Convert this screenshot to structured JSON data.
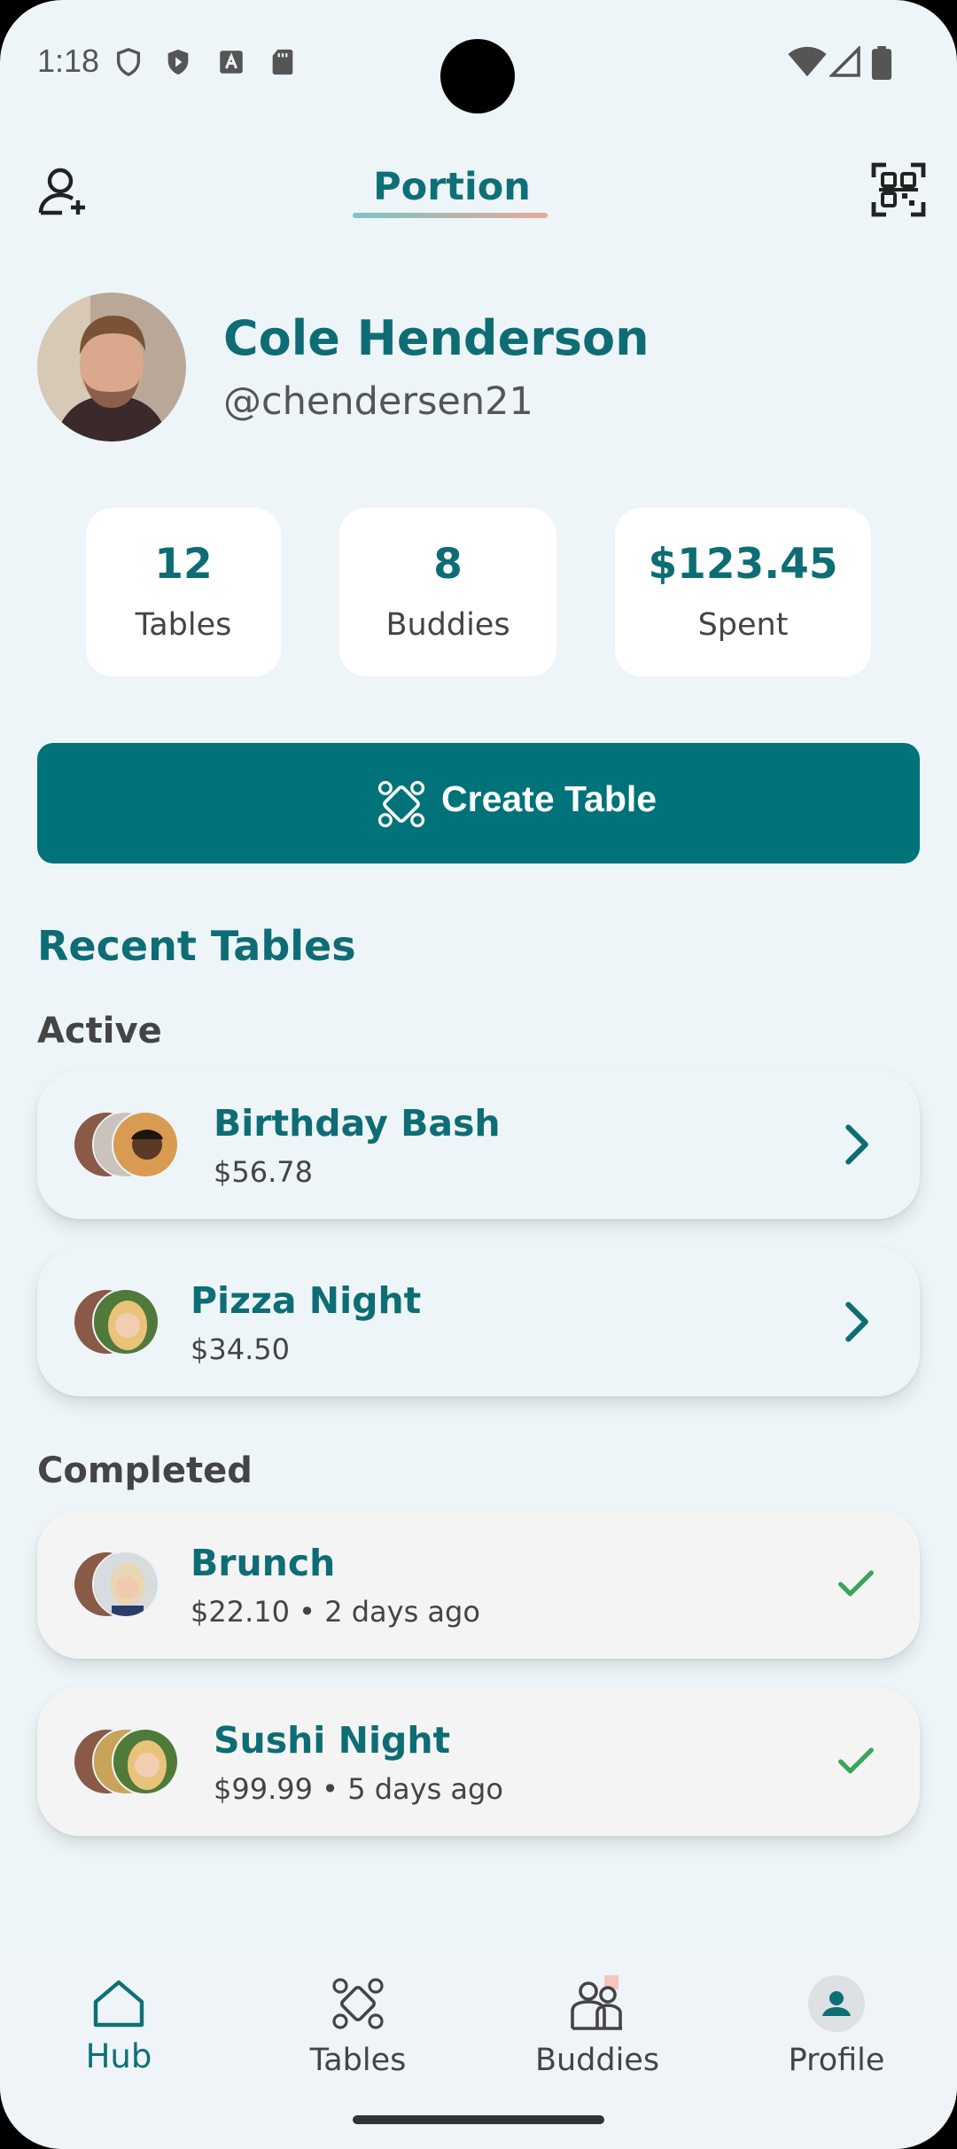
{
  "status_bar": {
    "time": "1:18"
  },
  "header": {
    "brand": "Portion"
  },
  "profile": {
    "name": "Cole Henderson",
    "handle": "@chendersen21"
  },
  "stats": [
    {
      "value": "12",
      "label": "Tables"
    },
    {
      "value": "8",
      "label": "Buddies"
    },
    {
      "value": "$123.45",
      "label": "Spent"
    }
  ],
  "create_button": {
    "label": "Create Table"
  },
  "recent": {
    "title": "Recent Tables",
    "active_label": "Active",
    "completed_label": "Completed",
    "active": [
      {
        "title": "Birthday Bash",
        "subtitle": "$56.78"
      },
      {
        "title": "Pizza Night",
        "subtitle": "$34.50"
      }
    ],
    "completed": [
      {
        "title": "Brunch",
        "subtitle": "$22.10 • 2 days ago"
      },
      {
        "title": "Sushi Night",
        "subtitle": "$99.99 • 5 days ago"
      }
    ]
  },
  "nav": [
    {
      "label": "Hub",
      "icon": "home-icon",
      "selected": true
    },
    {
      "label": "Tables",
      "icon": "tables-icon",
      "selected": false
    },
    {
      "label": "Buddies",
      "icon": "buddies-icon",
      "selected": false
    },
    {
      "label": "Profile",
      "icon": "profile-icon",
      "selected": false
    }
  ],
  "colors": {
    "primary": "#00727a",
    "title": "#0e6d74",
    "background": "#edf5f8",
    "check": "#3aa55b"
  }
}
